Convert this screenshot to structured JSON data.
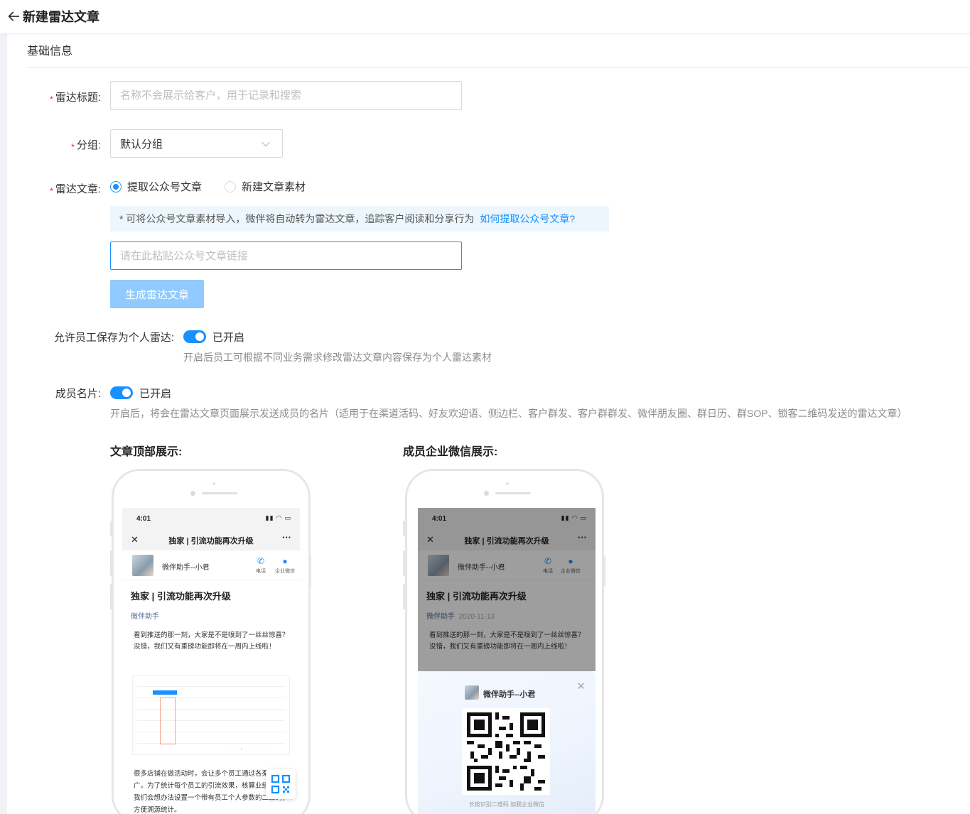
{
  "header": {
    "title": "新建雷达文章"
  },
  "section": {
    "title": "基础信息"
  },
  "form": {
    "title_field": {
      "label": "雷达标题:",
      "placeholder": "名称不会展示给客户，用于记录和搜索"
    },
    "group_field": {
      "label": "分组:",
      "value": "默认分组"
    },
    "article_field": {
      "label": "雷达文章:",
      "options": [
        "提取公众号文章",
        "新建文章素材"
      ],
      "selected": "提取公众号文章",
      "tip": "* 可将公众号文章素材导入，微伴将自动转为雷达文章，追踪客户阅读和分享行为",
      "tip_link": "如何提取公众号文章?",
      "link_placeholder": "请在此粘贴公众号文章链接",
      "generate_button": "生成雷达文章"
    },
    "allow_save": {
      "label": "允许员工保存为个人雷达:",
      "state": "已开启",
      "hint": "开启后员工可根据不同业务需求修改雷达文章内容保存为个人雷达素材"
    },
    "member_card": {
      "label": "成员名片:",
      "state": "已开启",
      "hint": "开启后，将会在雷达文章页面展示发送成员的名片（适用于在渠道活码、好友欢迎语、侧边栏、客户群发、客户群群发、微伴朋友圈、群日历、群SOP、锁客二维码发送的雷达文章）"
    }
  },
  "previews": {
    "top": {
      "title": "文章顶部展示:"
    },
    "wecom": {
      "title": "成员企业微信展示:"
    }
  },
  "phone": {
    "time": "4:01",
    "nav_title": "独家 | 引流功能再次升级",
    "member_name": "微伴助手--小君",
    "action_call": "电话",
    "action_wechat": "企业微信",
    "article_title": "独家 | 引流功能再次升级",
    "author": "微伴助手",
    "date": "2020-11-13",
    "body_1": "看到推送的那一刻，大家是不是嗅到了一丝丝惊喜？没错，我们又有重磅功能即将在一周内上线啦！",
    "body_2": "很多店铺在做活动时，会让多个员工通过各渠道推广。为了统计每个员工的引流效果，核算业绩，通常我们会想办法设置一个带有员工个人参数的二维码，方便溯源统计。",
    "qr_tip": "长按识别二维码 加我企业微信"
  },
  "colors": {
    "primary": "#1890ff",
    "required": "#f5222d",
    "disabled_button": "#91caff",
    "tip_bg": "#edf6fd"
  }
}
